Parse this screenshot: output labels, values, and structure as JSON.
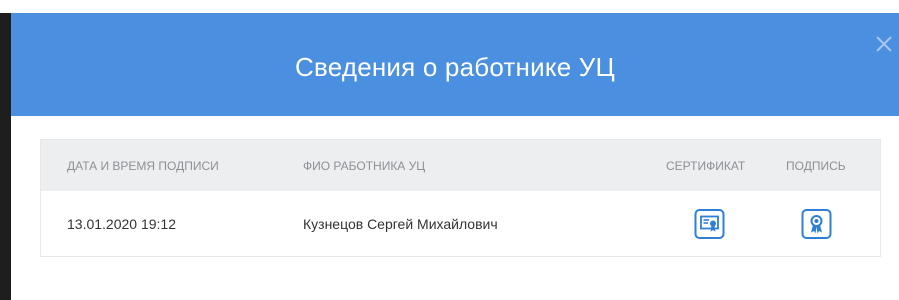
{
  "dialog": {
    "title": "Сведения о работнике УЦ",
    "close_icon": "close-icon"
  },
  "table": {
    "columns": {
      "datetime": "ДАТА И ВРЕМЯ ПОДПИСИ",
      "employee": "ФИО РАБОТНИКА УЦ",
      "certificate": "СЕРТИФИКАТ",
      "signature": "ПОДПИСЬ"
    },
    "rows": [
      {
        "datetime": "13.01.2020  19:12",
        "employee": "Кузнецов Сергей Михайлович",
        "certificate_icon": "certificate-icon",
        "signature_icon": "award-ribbon-icon"
      }
    ]
  },
  "colors": {
    "header_bg": "#4a8fe0",
    "accent_icon": "#2f7fd6",
    "table_header_bg": "#eceef0"
  }
}
